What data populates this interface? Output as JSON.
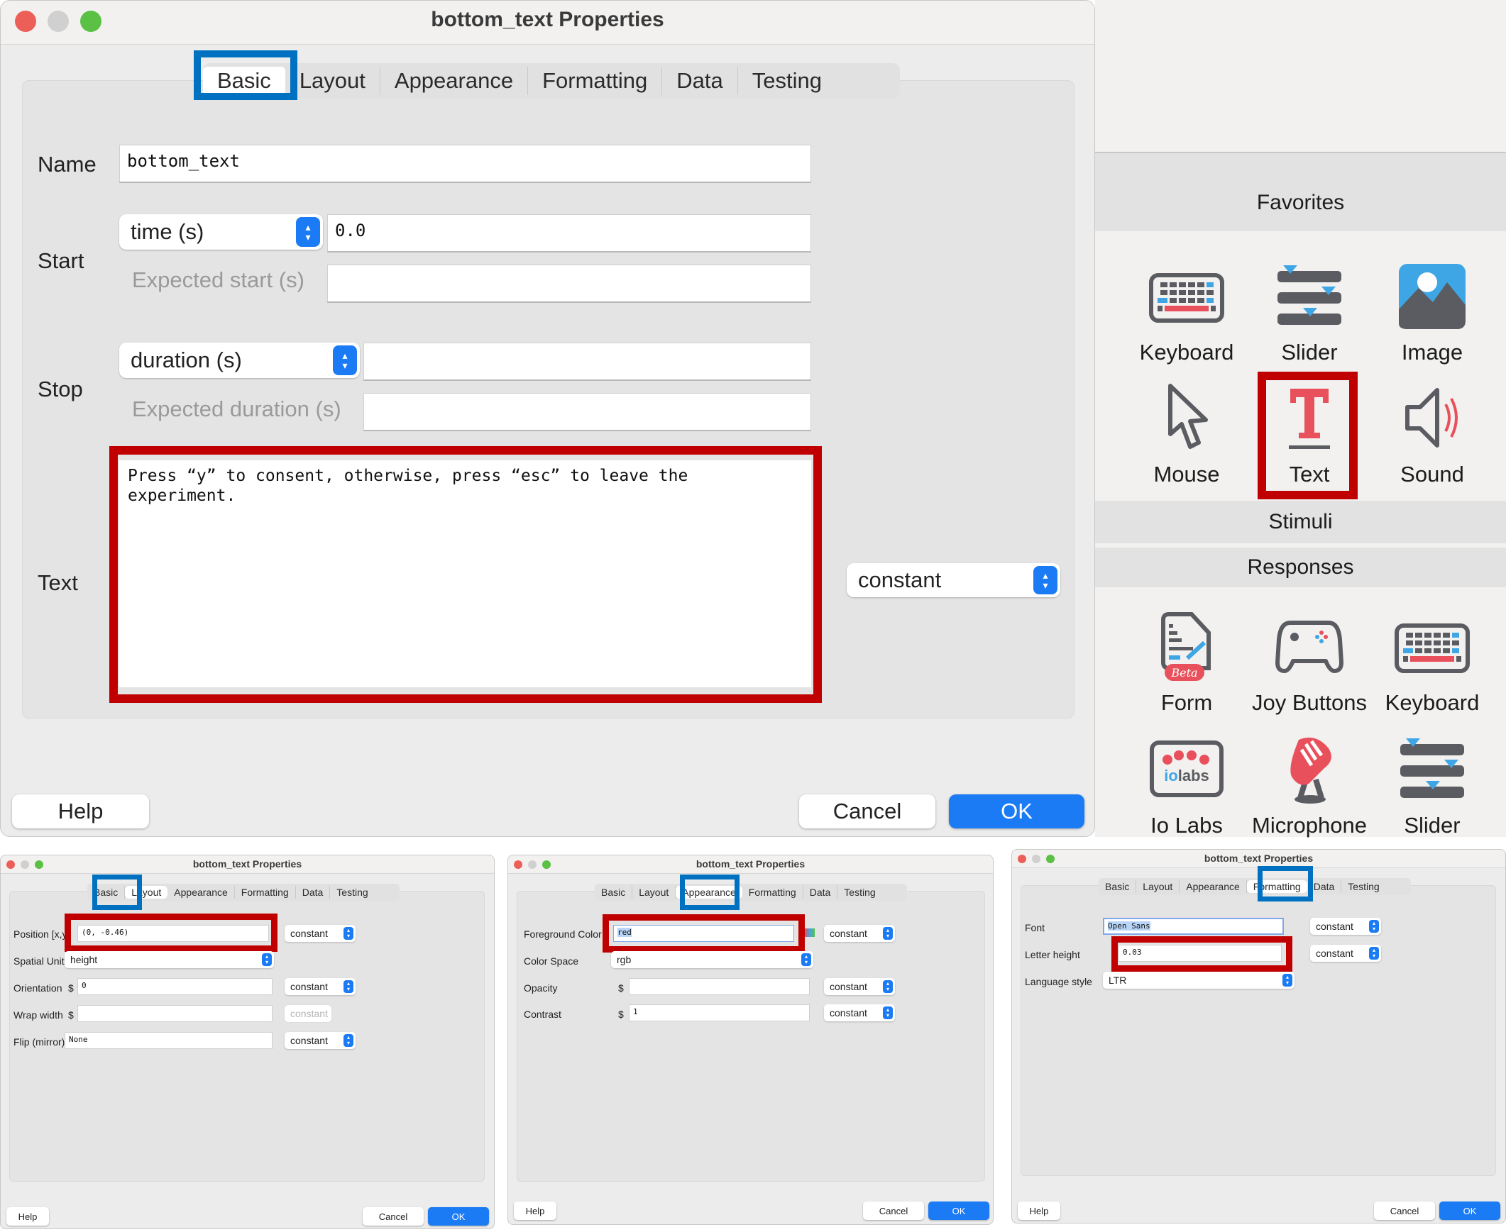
{
  "main_dialog": {
    "title": "bottom_text Properties",
    "tabs": [
      "Basic",
      "Layout",
      "Appearance",
      "Formatting",
      "Data",
      "Testing"
    ],
    "active_tab": "Basic",
    "fields": {
      "name_label": "Name",
      "name_value": "bottom_text",
      "start_label": "Start",
      "start_type": "time (s)",
      "start_value": "0.0",
      "expected_start_label": "Expected start (s)",
      "expected_start_value": "",
      "stop_label": "Stop",
      "stop_type": "duration (s)",
      "stop_value": "",
      "expected_duration_label": "Expected duration (s)",
      "expected_duration_value": "",
      "text_label": "Text",
      "text_value": "Press “y” to consent, otherwise, press “esc” to leave the\nexperiment.",
      "text_update": "constant"
    },
    "buttons": {
      "help": "Help",
      "cancel": "Cancel",
      "ok": "OK"
    }
  },
  "components_panel": {
    "sections": [
      {
        "title": "Favorites",
        "items": [
          {
            "label": "Keyboard",
            "icon": "keyboard-icon"
          },
          {
            "label": "Slider",
            "icon": "slider-icon"
          },
          {
            "label": "Image",
            "icon": "image-icon"
          },
          {
            "label": "Mouse",
            "icon": "mouse-cursor-icon"
          },
          {
            "label": "Text",
            "icon": "text-icon",
            "highlighted": true
          },
          {
            "label": "Sound",
            "icon": "speaker-icon"
          }
        ]
      },
      {
        "title": "Stimuli",
        "items": []
      },
      {
        "title": "Responses",
        "items": [
          {
            "label": "Form",
            "icon": "form-beta-icon"
          },
          {
            "label": "Joy Buttons",
            "icon": "gamepad-icon"
          },
          {
            "label": "Keyboard",
            "icon": "keyboard-icon"
          },
          {
            "label": "Io Labs",
            "icon": "iolabs-icon"
          },
          {
            "label": "Microphone",
            "icon": "microphone-icon"
          },
          {
            "label": "Slider",
            "icon": "slider-icon"
          }
        ]
      }
    ]
  },
  "layout_panel": {
    "title": "bottom_text Properties",
    "tabs": [
      "Basic",
      "Layout",
      "Appearance",
      "Formatting",
      "Data",
      "Testing"
    ],
    "active_tab": "Layout",
    "rows": [
      {
        "label": "Position [x,y]",
        "value": "(0, -0.46)",
        "update": "constant"
      },
      {
        "label": "Spatial Units",
        "value": "height"
      },
      {
        "label": "Orientation",
        "prefix": "$",
        "value": "0",
        "update": "constant"
      },
      {
        "label": "Wrap width",
        "prefix": "$",
        "value": "",
        "update": "constant"
      },
      {
        "label": "Flip (mirror)",
        "value": "None",
        "update": "constant"
      }
    ],
    "buttons": {
      "help": "Help",
      "cancel": "Cancel",
      "ok": "OK"
    }
  },
  "appearance_panel": {
    "title": "bottom_text Properties",
    "tabs": [
      "Basic",
      "Layout",
      "Appearance",
      "Formatting",
      "Data",
      "Testing"
    ],
    "active_tab": "Appearance",
    "rows": [
      {
        "label": "Foreground Color",
        "value": "red",
        "update": "constant"
      },
      {
        "label": "Color Space",
        "value": "rgb"
      },
      {
        "label": "Opacity",
        "prefix": "$",
        "value": "",
        "update": "constant"
      },
      {
        "label": "Contrast",
        "prefix": "$",
        "value": "1",
        "update": "constant"
      }
    ],
    "buttons": {
      "help": "Help",
      "cancel": "Cancel",
      "ok": "OK"
    }
  },
  "formatting_panel": {
    "title": "bottom_text Properties",
    "tabs": [
      "Basic",
      "Layout",
      "Appearance",
      "Formatting",
      "Data",
      "Testing"
    ],
    "active_tab": "Formatting",
    "rows": [
      {
        "label": "Font",
        "value": "Open Sans",
        "update": "constant"
      },
      {
        "label": "Letter height",
        "value": "0.03",
        "update": "constant"
      },
      {
        "label": "Language style",
        "value": "LTR"
      }
    ],
    "buttons": {
      "help": "Help",
      "cancel": "Cancel",
      "ok": "OK"
    }
  },
  "annotation_colors": {
    "highlight_tab": "#0070c0",
    "highlight_field": "#c00000",
    "accent_blue": "#1b7bf5"
  }
}
